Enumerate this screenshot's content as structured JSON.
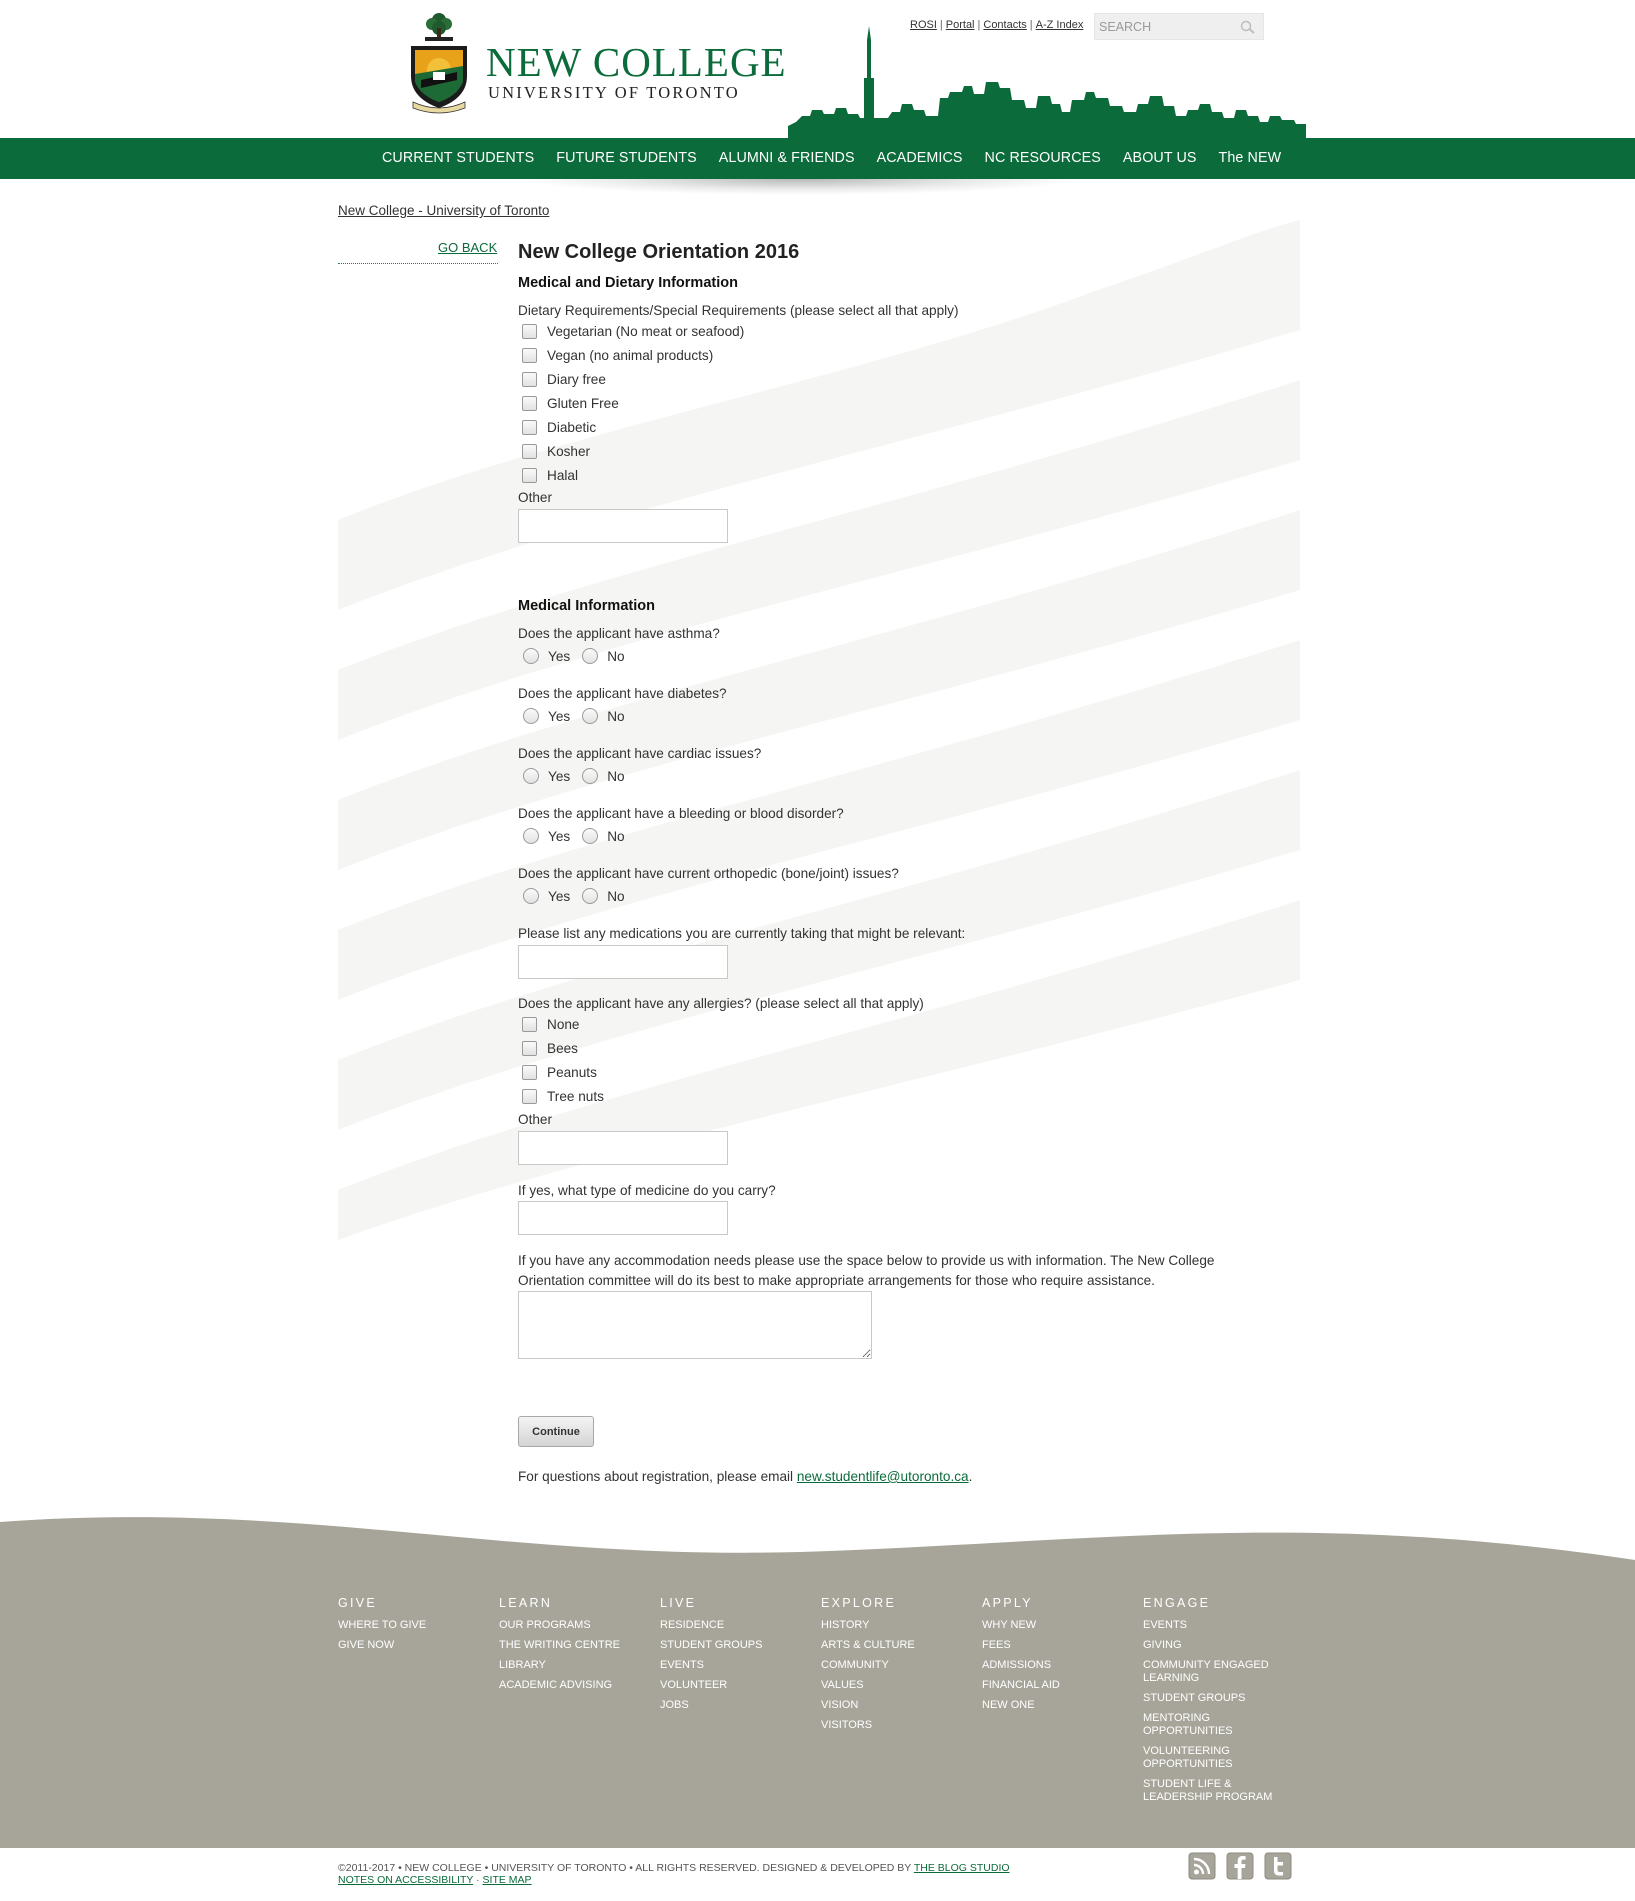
{
  "header": {
    "brand_title": "NEW COLLEGE",
    "brand_subtitle": "UNIVERSITY OF TORONTO",
    "util_links": [
      "ROSI",
      "Portal",
      "Contacts",
      "A-Z Index"
    ],
    "search_placeholder": "SEARCH"
  },
  "nav": {
    "items": [
      "CURRENT STUDENTS",
      "FUTURE STUDENTS",
      "ALUMNI & FRIENDS",
      "ACADEMICS",
      "NC RESOURCES",
      "ABOUT US",
      "The NEW"
    ]
  },
  "breadcrumb": "New College - University of Toronto",
  "sidebar": {
    "go_back": "GO BACK"
  },
  "form": {
    "title": "New College Orientation 2016",
    "dietary_section": "Medical and Dietary Information",
    "dietary_question": "Dietary Requirements/Special Requirements (please select all that apply)",
    "dietary_options": [
      "Vegetarian (No meat or seafood)",
      "Vegan (no animal products)",
      "Diary free",
      "Gluten Free",
      "Diabetic",
      "Kosher",
      "Halal"
    ],
    "dietary_other_label": "Other",
    "medical_section": "Medical Information",
    "yes_label": "Yes",
    "no_label": "No",
    "medical_questions": [
      "Does the applicant have asthma?",
      "Does the applicant have diabetes?",
      "Does the applicant have cardiac issues?",
      "Does the applicant have a bleeding or blood disorder?",
      "Does the applicant have current orthopedic (bone/joint) issues?"
    ],
    "medications_question": "Please list any medications you are currently taking that might be relevant:",
    "allergies_question": "Does the applicant have any allergies? (please select all that apply)",
    "allergy_options": [
      "None",
      "Bees",
      "Peanuts",
      "Tree nuts"
    ],
    "allergy_other_label": "Other",
    "medicine_carry_question": "If yes, what type of medicine do you carry?",
    "accommodation_text": "If you have any accommodation needs please use the space below to provide us with information. The New College Orientation committee will do its best to make appropriate arrangements for those who require assistance.",
    "continue_label": "Continue",
    "questions_prefix": "For questions about registration, please email ",
    "questions_email": "new.studentlife@utoronto.ca",
    "questions_suffix": "."
  },
  "footer": {
    "columns": [
      {
        "heading": "GIVE",
        "items": [
          "WHERE TO GIVE",
          "GIVE NOW"
        ]
      },
      {
        "heading": "LEARN",
        "items": [
          "OUR PROGRAMS",
          "THE WRITING CENTRE",
          "LIBRARY",
          "ACADEMIC ADVISING"
        ]
      },
      {
        "heading": "LIVE",
        "items": [
          "RESIDENCE",
          "STUDENT GROUPS",
          "EVENTS",
          "VOLUNTEER",
          "JOBS"
        ]
      },
      {
        "heading": "EXPLORE",
        "items": [
          "HISTORY",
          "ARTS & CULTURE",
          "COMMUNITY",
          "VALUES",
          "VISION",
          "VISITORS"
        ]
      },
      {
        "heading": "APPLY",
        "items": [
          "WHY NEW",
          "FEES",
          "ADMISSIONS",
          "FINANCIAL AID",
          "NEW ONE"
        ]
      },
      {
        "heading": "ENGAGE",
        "items": [
          "EVENTS",
          "GIVING",
          "COMMUNITY ENGAGED LEARNING",
          "STUDENT GROUPS",
          "MENTORING OPPORTUNITIES",
          "VOLUNTEERING OPPORTUNITIES",
          "STUDENT LIFE & LEADERSHIP PROGRAM"
        ]
      }
    ],
    "copyright_text": "©2011-2017 • NEW COLLEGE • UNIVERSITY OF TORONTO • ALL RIGHTS RESERVED. DESIGNED & DEVELOPED BY ",
    "designer_link": "THE BLOG STUDIO",
    "accessibility_link": "NOTES ON ACCESSIBILITY",
    "separator": " · ",
    "sitemap_link": "SITE MAP",
    "social_icons": [
      "rss-icon",
      "facebook-icon",
      "twitter-icon"
    ]
  },
  "colors": {
    "brand_green": "#0b6b3a",
    "footer_bg": "#a7a599"
  }
}
